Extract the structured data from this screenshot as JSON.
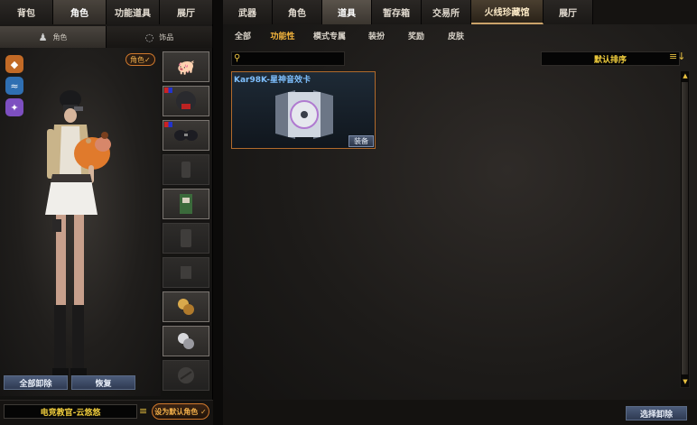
{
  "left_tabs": [
    {
      "label": "背包"
    },
    {
      "label": "角色",
      "active": true
    },
    {
      "label": "功能道具"
    },
    {
      "label": "展厅"
    }
  ],
  "left_subtabs": [
    {
      "label": "角色",
      "icon": "character-icon",
      "active": true
    },
    {
      "label": "饰品",
      "icon": "accessory-icon"
    }
  ],
  "role_tag": "角色✓",
  "actions": {
    "remove_all": "全部卸除",
    "restore": "恢复"
  },
  "player_name": "电竞教官-云悠悠",
  "set_default": "设为默认角色 ✓",
  "right_tabs": [
    {
      "label": "武器"
    },
    {
      "label": "角色"
    },
    {
      "label": "道具",
      "active": true
    },
    {
      "label": "暂存箱"
    },
    {
      "label": "交易所"
    },
    {
      "label": "火线珍藏馆",
      "special": true
    },
    {
      "label": "展厅"
    }
  ],
  "filters": [
    {
      "label": "全部"
    },
    {
      "label": "功能性",
      "active": true
    },
    {
      "label": "模式专属"
    },
    {
      "label": "装扮"
    },
    {
      "label": "奖励"
    },
    {
      "label": "皮肤"
    }
  ],
  "sort": {
    "label": "默认排序"
  },
  "item": {
    "title": "Kar98K-星神音效卡",
    "equip": "装备"
  },
  "select_remove": "选择卸除",
  "colors": {
    "accent": "#f3b43d",
    "card_border": "#b06a2c",
    "title_blue": "#7fc0ff"
  }
}
